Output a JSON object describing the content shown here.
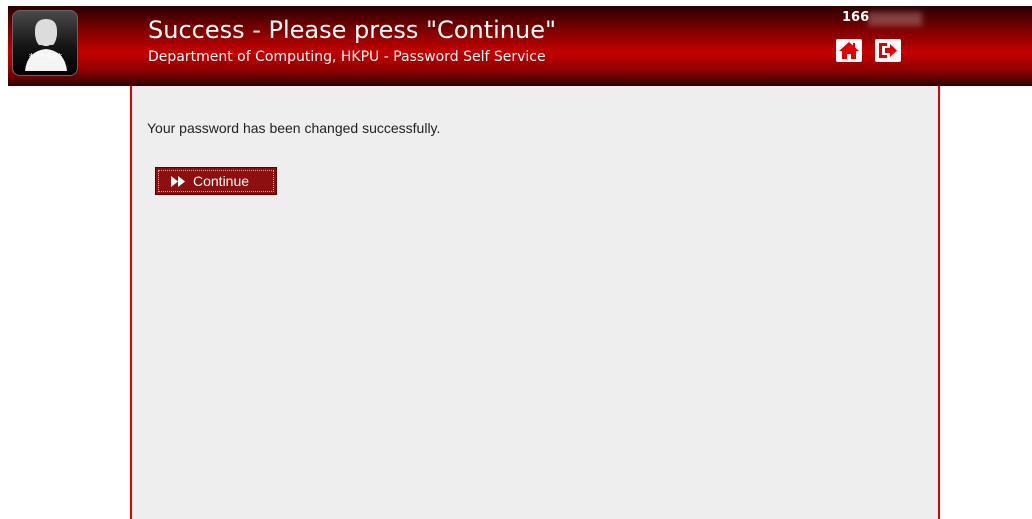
{
  "header": {
    "logo_stars": "******",
    "title": "Success - Please press \"Continue\"",
    "subtitle": "Department of Computing, HKPU - Password Self Service",
    "user_id": "166",
    "home_icon": "home-icon",
    "logout_icon": "sign-out-icon",
    "colors": {
      "bar": "#c40000",
      "icon": "#e00000"
    }
  },
  "main": {
    "message": "Your password has been changed successfully.",
    "continue_label": "Continue",
    "continue_icon": "fast-forward-icon",
    "colors": {
      "panel": "#eeeeee",
      "border": "#e00000",
      "button": "#8c1010"
    }
  }
}
